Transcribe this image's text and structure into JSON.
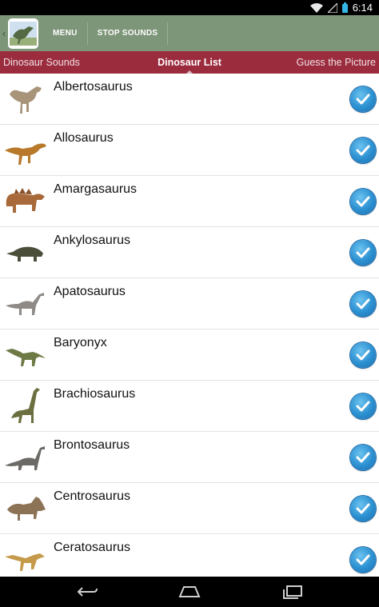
{
  "status": {
    "time": "6:14"
  },
  "action_bar": {
    "menu_label": "MENU",
    "stop_label": "STOP SOUNDS"
  },
  "tabs": [
    {
      "label": "Dinosaur Sounds"
    },
    {
      "label": "Dinosaur List"
    },
    {
      "label": "Guess the Picture"
    }
  ],
  "dinosaurs": [
    {
      "name": "Albertosaurus",
      "checked": true
    },
    {
      "name": "Allosaurus",
      "checked": true
    },
    {
      "name": "Amargasaurus",
      "checked": true
    },
    {
      "name": "Ankylosaurus",
      "checked": true
    },
    {
      "name": "Apatosaurus",
      "checked": true
    },
    {
      "name": "Baryonyx",
      "checked": true
    },
    {
      "name": "Brachiosaurus",
      "checked": true
    },
    {
      "name": "Brontosaurus",
      "checked": true
    },
    {
      "name": "Centrosaurus",
      "checked": true
    },
    {
      "name": "Ceratosaurus",
      "checked": true
    }
  ],
  "colors": {
    "action_bar": "#7d9578",
    "tab_strip": "#9b2c3e",
    "check": "#2a8fd0"
  }
}
